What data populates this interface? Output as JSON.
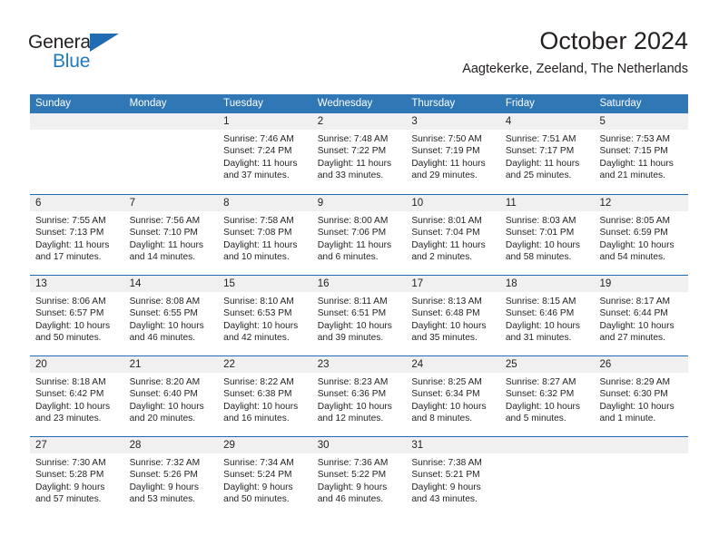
{
  "brand": {
    "name_part1": "General",
    "name_part2": "Blue",
    "accent_color": "#1f6cb4",
    "triangle_icon": "triangle-icon"
  },
  "header": {
    "title": "October 2024",
    "subtitle": "Aagtekerke, Zeeland, The Netherlands"
  },
  "calendar": {
    "header_bg": "#2f77b5",
    "week_divider_color": "#1f6cb4",
    "day_band_bg": "#f0f0f0",
    "day_names": [
      "Sunday",
      "Monday",
      "Tuesday",
      "Wednesday",
      "Thursday",
      "Friday",
      "Saturday"
    ],
    "weeks": [
      [
        {
          "day": "",
          "sunrise": "",
          "sunset": "",
          "daylight": "",
          "daylight2": "",
          "empty": true
        },
        {
          "day": "",
          "sunrise": "",
          "sunset": "",
          "daylight": "",
          "daylight2": "",
          "empty": true
        },
        {
          "day": "1",
          "sunrise": "Sunrise: 7:46 AM",
          "sunset": "Sunset: 7:24 PM",
          "daylight": "Daylight: 11 hours",
          "daylight2": "and 37 minutes."
        },
        {
          "day": "2",
          "sunrise": "Sunrise: 7:48 AM",
          "sunset": "Sunset: 7:22 PM",
          "daylight": "Daylight: 11 hours",
          "daylight2": "and 33 minutes."
        },
        {
          "day": "3",
          "sunrise": "Sunrise: 7:50 AM",
          "sunset": "Sunset: 7:19 PM",
          "daylight": "Daylight: 11 hours",
          "daylight2": "and 29 minutes."
        },
        {
          "day": "4",
          "sunrise": "Sunrise: 7:51 AM",
          "sunset": "Sunset: 7:17 PM",
          "daylight": "Daylight: 11 hours",
          "daylight2": "and 25 minutes."
        },
        {
          "day": "5",
          "sunrise": "Sunrise: 7:53 AM",
          "sunset": "Sunset: 7:15 PM",
          "daylight": "Daylight: 11 hours",
          "daylight2": "and 21 minutes."
        }
      ],
      [
        {
          "day": "6",
          "sunrise": "Sunrise: 7:55 AM",
          "sunset": "Sunset: 7:13 PM",
          "daylight": "Daylight: 11 hours",
          "daylight2": "and 17 minutes."
        },
        {
          "day": "7",
          "sunrise": "Sunrise: 7:56 AM",
          "sunset": "Sunset: 7:10 PM",
          "daylight": "Daylight: 11 hours",
          "daylight2": "and 14 minutes."
        },
        {
          "day": "8",
          "sunrise": "Sunrise: 7:58 AM",
          "sunset": "Sunset: 7:08 PM",
          "daylight": "Daylight: 11 hours",
          "daylight2": "and 10 minutes."
        },
        {
          "day": "9",
          "sunrise": "Sunrise: 8:00 AM",
          "sunset": "Sunset: 7:06 PM",
          "daylight": "Daylight: 11 hours",
          "daylight2": "and 6 minutes."
        },
        {
          "day": "10",
          "sunrise": "Sunrise: 8:01 AM",
          "sunset": "Sunset: 7:04 PM",
          "daylight": "Daylight: 11 hours",
          "daylight2": "and 2 minutes."
        },
        {
          "day": "11",
          "sunrise": "Sunrise: 8:03 AM",
          "sunset": "Sunset: 7:01 PM",
          "daylight": "Daylight: 10 hours",
          "daylight2": "and 58 minutes."
        },
        {
          "day": "12",
          "sunrise": "Sunrise: 8:05 AM",
          "sunset": "Sunset: 6:59 PM",
          "daylight": "Daylight: 10 hours",
          "daylight2": "and 54 minutes."
        }
      ],
      [
        {
          "day": "13",
          "sunrise": "Sunrise: 8:06 AM",
          "sunset": "Sunset: 6:57 PM",
          "daylight": "Daylight: 10 hours",
          "daylight2": "and 50 minutes."
        },
        {
          "day": "14",
          "sunrise": "Sunrise: 8:08 AM",
          "sunset": "Sunset: 6:55 PM",
          "daylight": "Daylight: 10 hours",
          "daylight2": "and 46 minutes."
        },
        {
          "day": "15",
          "sunrise": "Sunrise: 8:10 AM",
          "sunset": "Sunset: 6:53 PM",
          "daylight": "Daylight: 10 hours",
          "daylight2": "and 42 minutes."
        },
        {
          "day": "16",
          "sunrise": "Sunrise: 8:11 AM",
          "sunset": "Sunset: 6:51 PM",
          "daylight": "Daylight: 10 hours",
          "daylight2": "and 39 minutes."
        },
        {
          "day": "17",
          "sunrise": "Sunrise: 8:13 AM",
          "sunset": "Sunset: 6:48 PM",
          "daylight": "Daylight: 10 hours",
          "daylight2": "and 35 minutes."
        },
        {
          "day": "18",
          "sunrise": "Sunrise: 8:15 AM",
          "sunset": "Sunset: 6:46 PM",
          "daylight": "Daylight: 10 hours",
          "daylight2": "and 31 minutes."
        },
        {
          "day": "19",
          "sunrise": "Sunrise: 8:17 AM",
          "sunset": "Sunset: 6:44 PM",
          "daylight": "Daylight: 10 hours",
          "daylight2": "and 27 minutes."
        }
      ],
      [
        {
          "day": "20",
          "sunrise": "Sunrise: 8:18 AM",
          "sunset": "Sunset: 6:42 PM",
          "daylight": "Daylight: 10 hours",
          "daylight2": "and 23 minutes."
        },
        {
          "day": "21",
          "sunrise": "Sunrise: 8:20 AM",
          "sunset": "Sunset: 6:40 PM",
          "daylight": "Daylight: 10 hours",
          "daylight2": "and 20 minutes."
        },
        {
          "day": "22",
          "sunrise": "Sunrise: 8:22 AM",
          "sunset": "Sunset: 6:38 PM",
          "daylight": "Daylight: 10 hours",
          "daylight2": "and 16 minutes."
        },
        {
          "day": "23",
          "sunrise": "Sunrise: 8:23 AM",
          "sunset": "Sunset: 6:36 PM",
          "daylight": "Daylight: 10 hours",
          "daylight2": "and 12 minutes."
        },
        {
          "day": "24",
          "sunrise": "Sunrise: 8:25 AM",
          "sunset": "Sunset: 6:34 PM",
          "daylight": "Daylight: 10 hours",
          "daylight2": "and 8 minutes."
        },
        {
          "day": "25",
          "sunrise": "Sunrise: 8:27 AM",
          "sunset": "Sunset: 6:32 PM",
          "daylight": "Daylight: 10 hours",
          "daylight2": "and 5 minutes."
        },
        {
          "day": "26",
          "sunrise": "Sunrise: 8:29 AM",
          "sunset": "Sunset: 6:30 PM",
          "daylight": "Daylight: 10 hours",
          "daylight2": "and 1 minute."
        }
      ],
      [
        {
          "day": "27",
          "sunrise": "Sunrise: 7:30 AM",
          "sunset": "Sunset: 5:28 PM",
          "daylight": "Daylight: 9 hours",
          "daylight2": "and 57 minutes."
        },
        {
          "day": "28",
          "sunrise": "Sunrise: 7:32 AM",
          "sunset": "Sunset: 5:26 PM",
          "daylight": "Daylight: 9 hours",
          "daylight2": "and 53 minutes."
        },
        {
          "day": "29",
          "sunrise": "Sunrise: 7:34 AM",
          "sunset": "Sunset: 5:24 PM",
          "daylight": "Daylight: 9 hours",
          "daylight2": "and 50 minutes."
        },
        {
          "day": "30",
          "sunrise": "Sunrise: 7:36 AM",
          "sunset": "Sunset: 5:22 PM",
          "daylight": "Daylight: 9 hours",
          "daylight2": "and 46 minutes."
        },
        {
          "day": "31",
          "sunrise": "Sunrise: 7:38 AM",
          "sunset": "Sunset: 5:21 PM",
          "daylight": "Daylight: 9 hours",
          "daylight2": "and 43 minutes."
        },
        {
          "day": "",
          "sunrise": "",
          "sunset": "",
          "daylight": "",
          "daylight2": "",
          "empty": true
        },
        {
          "day": "",
          "sunrise": "",
          "sunset": "",
          "daylight": "",
          "daylight2": "",
          "empty": true
        }
      ]
    ]
  }
}
